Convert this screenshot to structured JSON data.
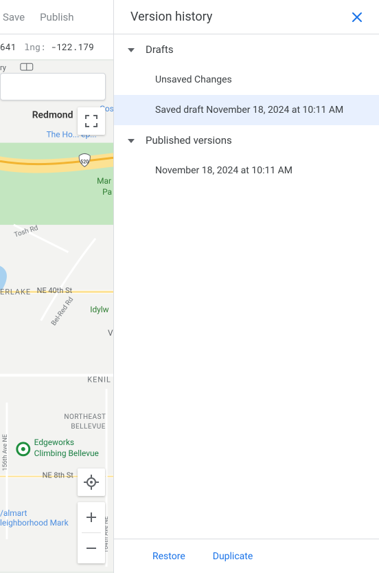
{
  "toolbar": {
    "save_label": "Save",
    "publish_label": "Publish"
  },
  "coords": {
    "lat_label_fragment": "641",
    "lng_label": "lng:",
    "lng_value": "-122.179"
  },
  "map": {
    "labels": {
      "redmond": "Redmond",
      "home_depot": "The Ho...   ep...",
      "mar": "Mar",
      "park_fragment": "Pa",
      "tosh_rd": "Tosh Rd",
      "erlake": "ERLAKE",
      "ne40th": "NE 40th St",
      "belred": "Bel-Red Rd",
      "idylw": "Idylw",
      "v": "V",
      "kenil": "KENIL",
      "ne_bellevue1": "NORTHEAST",
      "ne_bellevue2": "BELLEVUE",
      "edgeworks1": "Edgeworks",
      "edgeworks2": "Climbing Bellevue",
      "ne8th": "NE 8th St",
      "mart1": "/almart",
      "mart2": "leighborhood Mark",
      "ave164": "164th Ave NE",
      "ave156": "156th Ave NE",
      "shield520": "520",
      "library": "ry"
    }
  },
  "panel": {
    "title": "Version history",
    "drafts_section": "Drafts",
    "published_section": "Published versions",
    "drafts": [
      {
        "label": "Unsaved Changes",
        "selected": false
      },
      {
        "label": "Saved draft November 18, 2024 at 10:11 AM",
        "selected": true
      }
    ],
    "published": [
      {
        "label": "November 18, 2024 at 10:11 AM"
      }
    ],
    "restore_label": "Restore",
    "duplicate_label": "Duplicate"
  }
}
